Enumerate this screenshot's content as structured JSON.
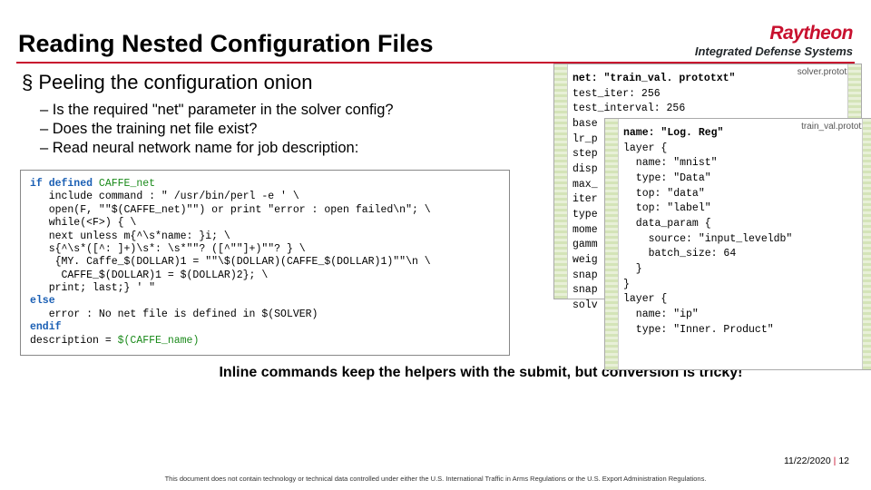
{
  "header": {
    "title": "Reading Nested Configuration Files",
    "logo_main": "Raytheon",
    "logo_sub": "Integrated Defense Systems"
  },
  "section": {
    "subtitle": "Peeling the configuration onion",
    "bullets": [
      "Is the required \"net\" parameter in the solver config?",
      "Does the training net file exist?",
      "Read neural network name for job description:"
    ]
  },
  "code": {
    "line1a": "if defined ",
    "line1b": "CAFFE_net",
    "line2": "   include command : \" /usr/bin/perl -e ' \\",
    "line3": "   open(F, \"\"$(CAFFE_net)\"\") or print \"error : open failed\\n\"; \\",
    "line4": "   while(<F>) { \\",
    "line5": "   next unless m{^\\s*name: }i; \\",
    "line6": "   s{^\\s*([^: ]+)\\s*: \\s*\"\"? ([^\"\"]+)\"\"? } \\",
    "line7": "    {MY. Caffe_$(DOLLAR)1 = \"\"\\$(DOLLAR)(CAFFE_$(DOLLAR)1)\"\"\\n \\",
    "line8": "     CAFFE_$(DOLLAR)1 = $(DOLLAR)2}; \\",
    "line9": "   print; last;} ' \"",
    "line10": "else",
    "line11": "   error : No net file is defined in $(SOLVER)",
    "line12": "endif",
    "line13a": "description = ",
    "line13b": "$(CAFFE_name)"
  },
  "solver": {
    "label": "solver.prototxt",
    "l1a": "net: ",
    "l1b": "\"train_val. prototxt\"",
    "l2": "test_iter: 256",
    "l3": "test_interval: 256",
    "l4": "base",
    "l5": "lr_p",
    "l6": "step",
    "l7": "disp",
    "l8": "max_",
    "l9": "iter",
    "l10": "type",
    "l11": "mome",
    "l12": "gamm",
    "l13": "weig",
    "l14": "snap",
    "l15": "snap",
    "l16": "solv"
  },
  "train": {
    "label": "train_val.prototxt",
    "l1a": "name: ",
    "l1b": "\"Log. Reg\"",
    "l2": "layer {",
    "l3": "  name: \"mnist\"",
    "l4": "  type: \"Data\"",
    "l5": "  top: \"data\"",
    "l6": "  top: \"label\"",
    "l7": "  data_param {",
    "l8": "    source: \"input_leveldb\"",
    "l9": "    batch_size: 64",
    "l10": "  }",
    "l11": "}",
    "l12": "layer {",
    "l13": "  name: \"ip\"",
    "l14": "  type: \"Inner. Product\""
  },
  "callout": "Inline commands keep the helpers with the submit, but conversion is tricky!",
  "footer": {
    "date": "11/22/2020",
    "page": "12"
  },
  "export": "This document does not contain technology or technical data controlled under either the U.S. International Traffic in Arms Regulations or the U.S. Export Administration Regulations."
}
